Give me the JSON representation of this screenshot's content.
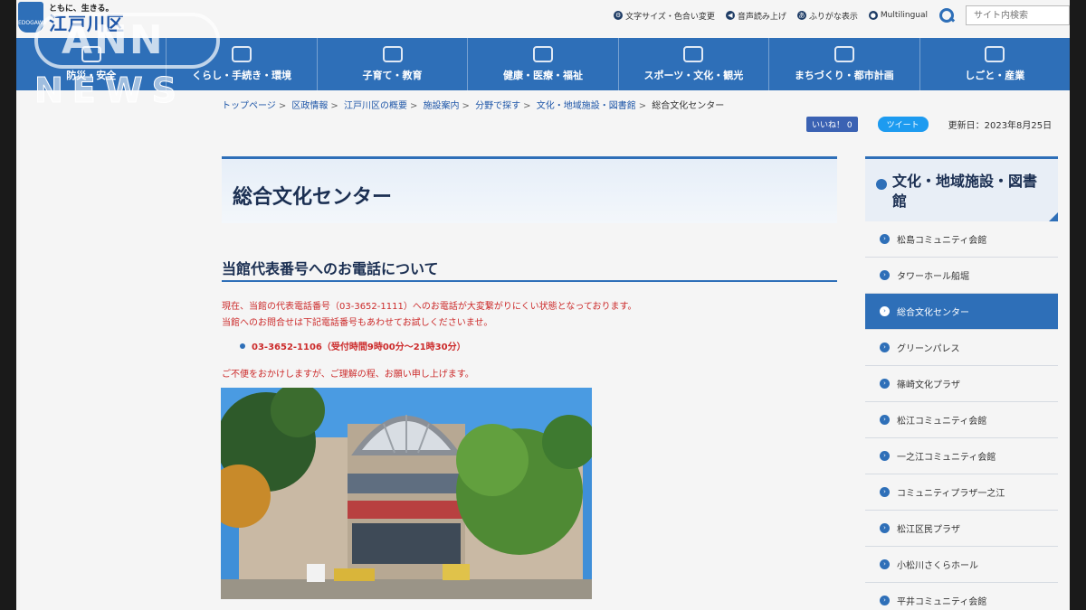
{
  "header": {
    "slogan": "ともに、生きる。",
    "site_name": "江戸川区",
    "tools": [
      {
        "label": "文字サイズ・色合い変更",
        "icon": "gear-icon"
      },
      {
        "label": "音声読み上げ",
        "icon": "speaker-icon"
      },
      {
        "label": "ふりがな表示",
        "icon": "furigana-icon"
      },
      {
        "label": "Multilingual",
        "icon": "globe-icon"
      }
    ],
    "search_placeholder": "サイト内検索"
  },
  "watermark": {
    "top": "ANN",
    "bottom": "NEWS"
  },
  "nav": [
    {
      "label": "防災・安全"
    },
    {
      "label": "くらし・手続き・環境"
    },
    {
      "label": "子育て・教育"
    },
    {
      "label": "健康・医療・福祉"
    },
    {
      "label": "スポーツ・文化・観光"
    },
    {
      "label": "まちづくり・都市計画"
    },
    {
      "label": "しごと・産業"
    }
  ],
  "breadcrumb": [
    "トップページ",
    "区政情報",
    "江戸川区の概要",
    "施設案内",
    "分野で探す",
    "文化・地域施設・図書館",
    "総合文化センター"
  ],
  "social": {
    "like": "いいね！ 0",
    "tweet": "ツイート",
    "updated": "更新日：2023年8月25日"
  },
  "page_title": "総合文化センター",
  "section_title": "当館代表番号へのお電話について",
  "notice": {
    "line1": "現在、当館の代表電話番号（03-3652-1111）へのお電話が大変繋がりにくい状態となっております。",
    "line2": "当館へのお問合せは下記電話番号もあわせてお試しくださいませ。",
    "phone": "03-3652-1106（受付時間9時00分～21時30分）",
    "apology": "ご不便をおかけしますが、ご理解の程、お願い申し上げます。"
  },
  "sidebar": {
    "heading": "文化・地域施設・図書館",
    "items": [
      {
        "label": "松島コミュニティ会館",
        "active": false
      },
      {
        "label": "タワーホール船堀",
        "active": false
      },
      {
        "label": "総合文化センター",
        "active": true
      },
      {
        "label": "グリーンパレス",
        "active": false
      },
      {
        "label": "篠崎文化プラザ",
        "active": false
      },
      {
        "label": "松江コミュニティ会館",
        "active": false
      },
      {
        "label": "一之江コミュニティ会館",
        "active": false
      },
      {
        "label": "コミュニティプラザ一之江",
        "active": false
      },
      {
        "label": "松江区民プラザ",
        "active": false
      },
      {
        "label": "小松川さくらホール",
        "active": false
      },
      {
        "label": "平井コミュニティ会館",
        "active": false
      }
    ]
  }
}
